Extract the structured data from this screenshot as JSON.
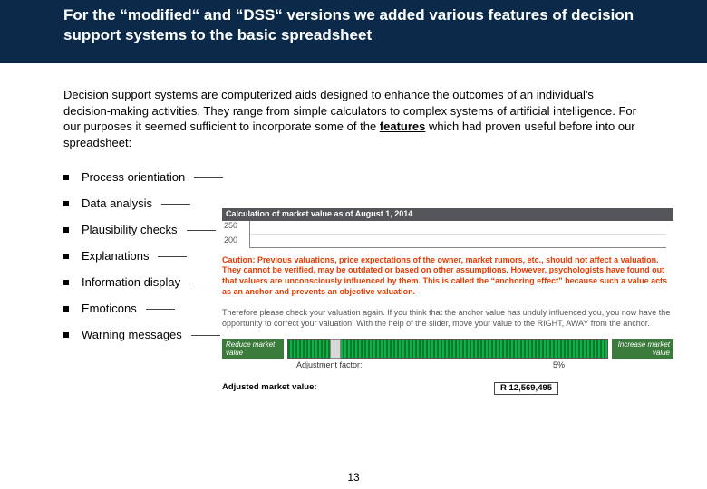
{
  "title": "For the “modified“ and “DSS“ versions we added various features of decision support systems to the basic spreadsheet",
  "para_pre": "Decision support systems are computerized aids designed to enhance the outcomes of an individual's decision-making activities. They range from simple calculators to complex systems of artificial intelligence. For our purposes it seemed sufficient to incorporate some of the ",
  "features_word": "features",
  "para_post": " which had proven useful before into our spreadsheet:",
  "bullets": [
    "Process orientiation",
    "Data analysis",
    "Plausibility checks",
    "Explanations",
    "Information display",
    "Emoticons",
    "Warning messages"
  ],
  "panel": {
    "chart_title": "Calculation of market value as of August 1, 2014",
    "y_top": "250",
    "y_bottom": "200",
    "caution": "Caution: Previous valuations, price expectations of the owner, market rumors, etc., should not affect a valuation. They cannot be verified, may be outdated or based on other assumptions. However, psychologists have found out that valuers are unconsciously influenced by them. This is called the “anchoring effect” because such a value acts as an anchor and prevents an objective valuation.",
    "therefore": "Therefore please check your valuation again. If you think that the anchor value has unduly influenced you, you now have the opportunity to correct your valuation. With the help of the slider, move your value to the RIGHT, AWAY from the anchor.",
    "reduce_label": "Reduce market value",
    "increase_label": "Increase market value",
    "adj_label": "Adjustment factor:",
    "adj_value": "5%",
    "adjusted_label": "Adjusted market value:",
    "adjusted_value": "R 12,569,495"
  },
  "page_number": "13"
}
